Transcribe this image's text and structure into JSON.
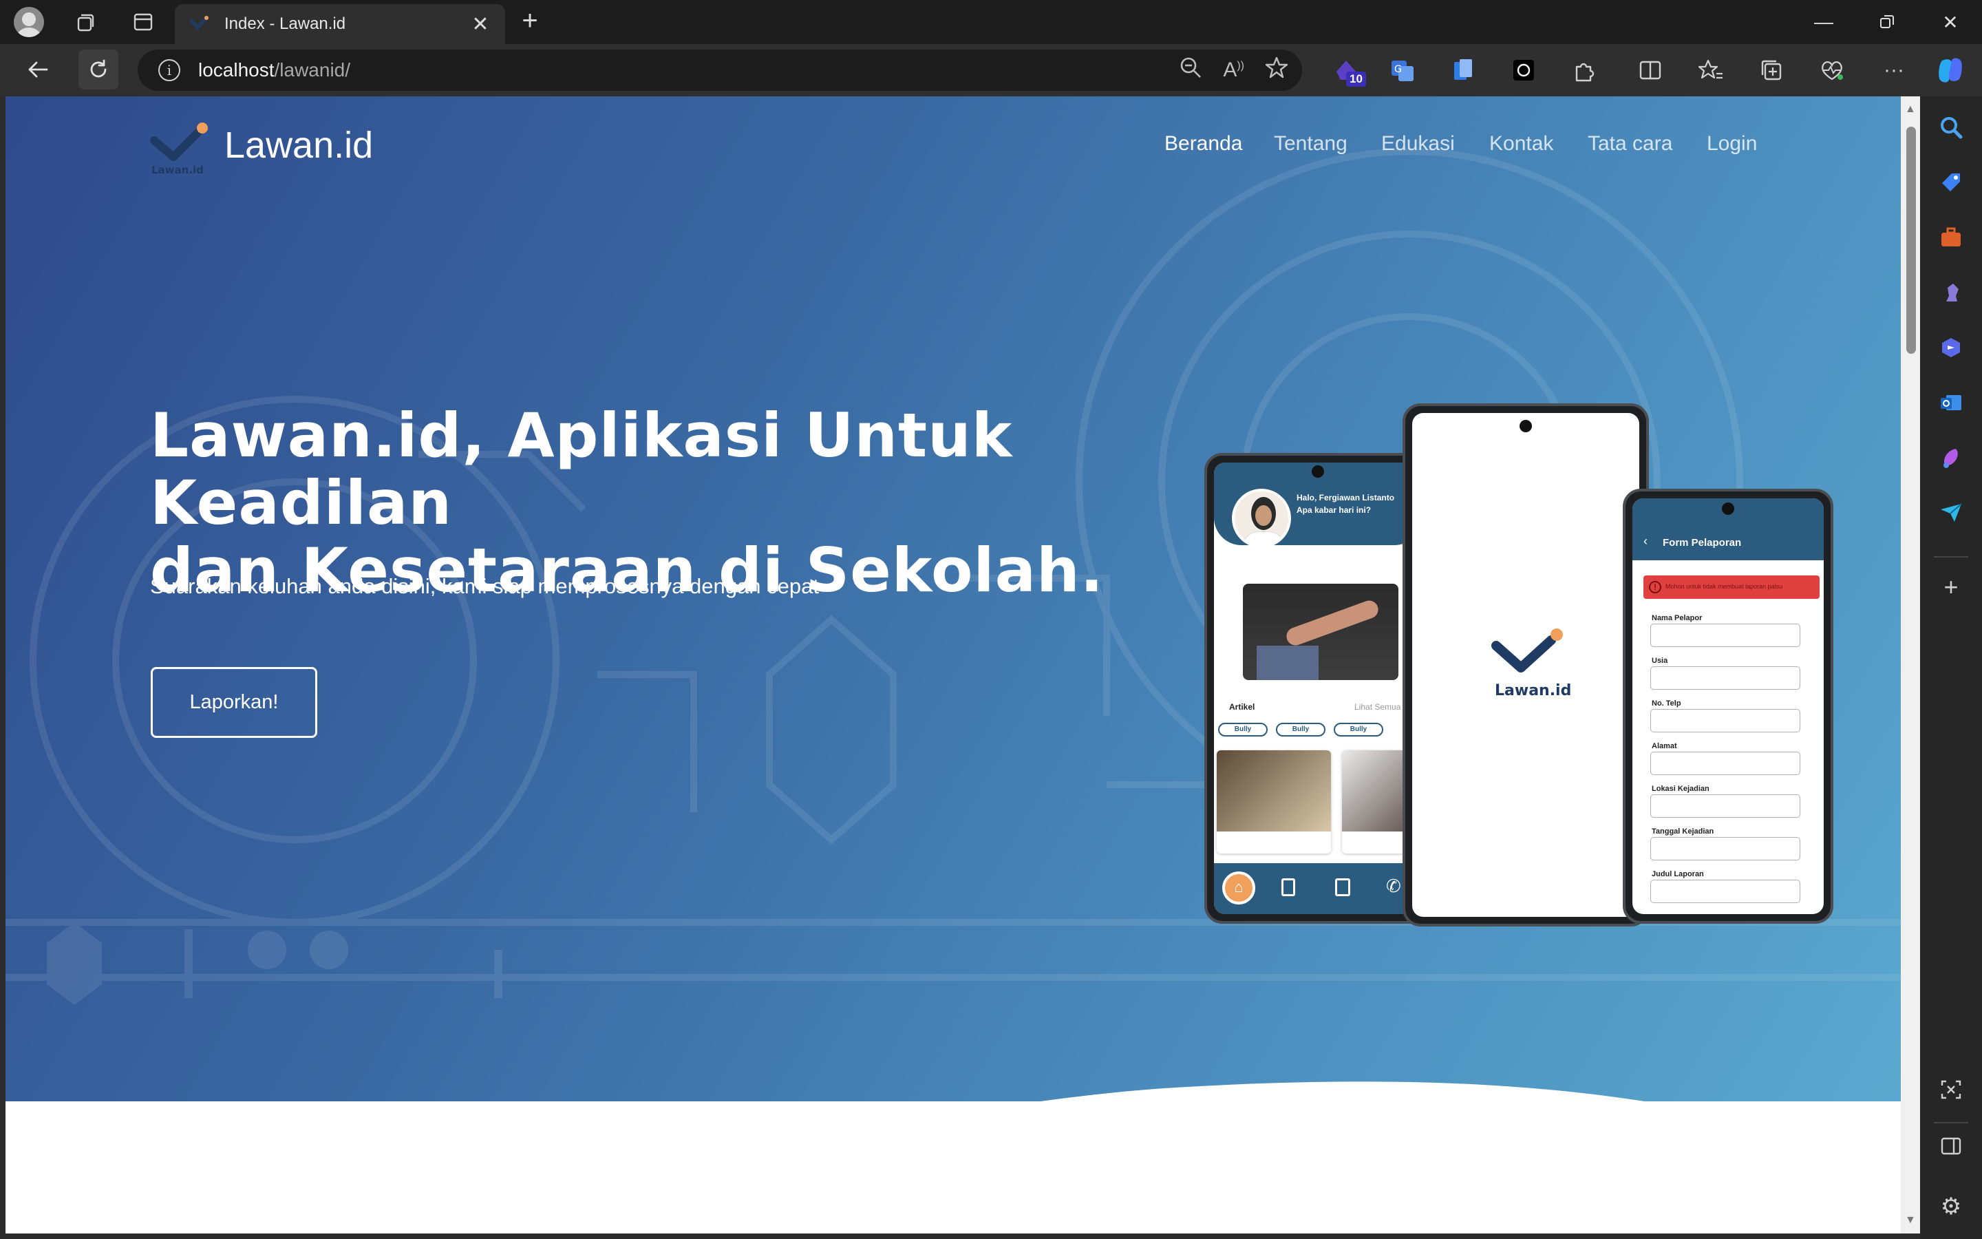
{
  "window": {
    "tab_title": "Index - Lawan.id",
    "new_tab": "+"
  },
  "address_bar": {
    "host": "localhost",
    "path": "/lawanid/"
  },
  "extensions": {
    "badge_count": "10"
  },
  "site": {
    "brand": "Lawan.id",
    "logo_text": "Lawan.id",
    "nav": [
      "Beranda",
      "Tentang",
      "Edukasi",
      "Kontak",
      "Tata cara",
      "Login"
    ],
    "active_nav": "Beranda",
    "headline_line1": "Lawan.id, Aplikasi Untuk Keadilan",
    "headline_line2": "dan Kesetaraan di Sekolah.",
    "subtitle": "Suarakan keluhan anda disini, kami siap memprosesnya dengan cepat",
    "cta": "Laporkan!"
  },
  "phone_left": {
    "greeting": "Halo, Fergiawan Listanto",
    "greeting_sub": "Apa kabar hari ini?",
    "articles_label": "Artikel",
    "see_all": "Lihat Semua",
    "chips": [
      "Bully",
      "Bully",
      "Bully"
    ]
  },
  "phone_center": {
    "logo_text": "Lawan.id"
  },
  "phone_right": {
    "header": "Form Pelaporan",
    "alert": "Mohon untuk tidak membuat laporan palsu",
    "fields": [
      "Nama Pelapor",
      "Usia",
      "No. Telp",
      "Alamat",
      "Lokasi Kejadian",
      "Tanggal Kejadian",
      "Judul Laporan"
    ]
  },
  "colors": {
    "hero_start": "#2f4a8c",
    "hero_end": "#5aa8cf",
    "phone_header": "#2b5b7e",
    "alert_red": "#e04040",
    "logo_navy": "#1f3b63",
    "logo_orange": "#f0a05a"
  }
}
